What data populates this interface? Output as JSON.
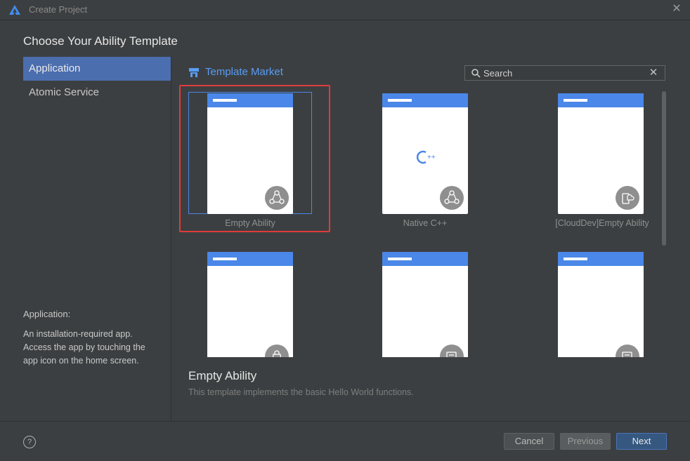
{
  "window": {
    "title": "Create Project"
  },
  "heading": "Choose Your Ability Template",
  "sidebar": {
    "items": [
      {
        "label": "Application",
        "active": true
      },
      {
        "label": "Atomic Service",
        "active": false
      }
    ],
    "description_title": "Application:",
    "description_text": "An installation-required app. Access the app by touching the app icon on the home screen."
  },
  "market": {
    "label": "Template Market"
  },
  "search": {
    "placeholder": "Search",
    "value": ""
  },
  "templates": [
    {
      "label": "Empty Ability",
      "badge": "ability-nodes-icon",
      "selected": true
    },
    {
      "label": "Native C++",
      "badge": "ability-nodes-icon",
      "center_icon": "cpp-icon"
    },
    {
      "label": "[CloudDev]Empty Ability",
      "badge": "cloud-device-icon"
    },
    {
      "label": "",
      "badge": "shopping-bag-icon"
    },
    {
      "label": "",
      "badge": "card-icon"
    },
    {
      "label": "",
      "badge": "card-icon"
    }
  ],
  "detail": {
    "title": "Empty Ability",
    "description": "This template implements the basic Hello World functions."
  },
  "footer": {
    "help": "?",
    "cancel": "Cancel",
    "previous": "Previous",
    "next": "Next"
  },
  "colors": {
    "accent": "#4a87e8",
    "link": "#589df6",
    "highlight": "#e03b3b",
    "background": "#3c3f41"
  }
}
